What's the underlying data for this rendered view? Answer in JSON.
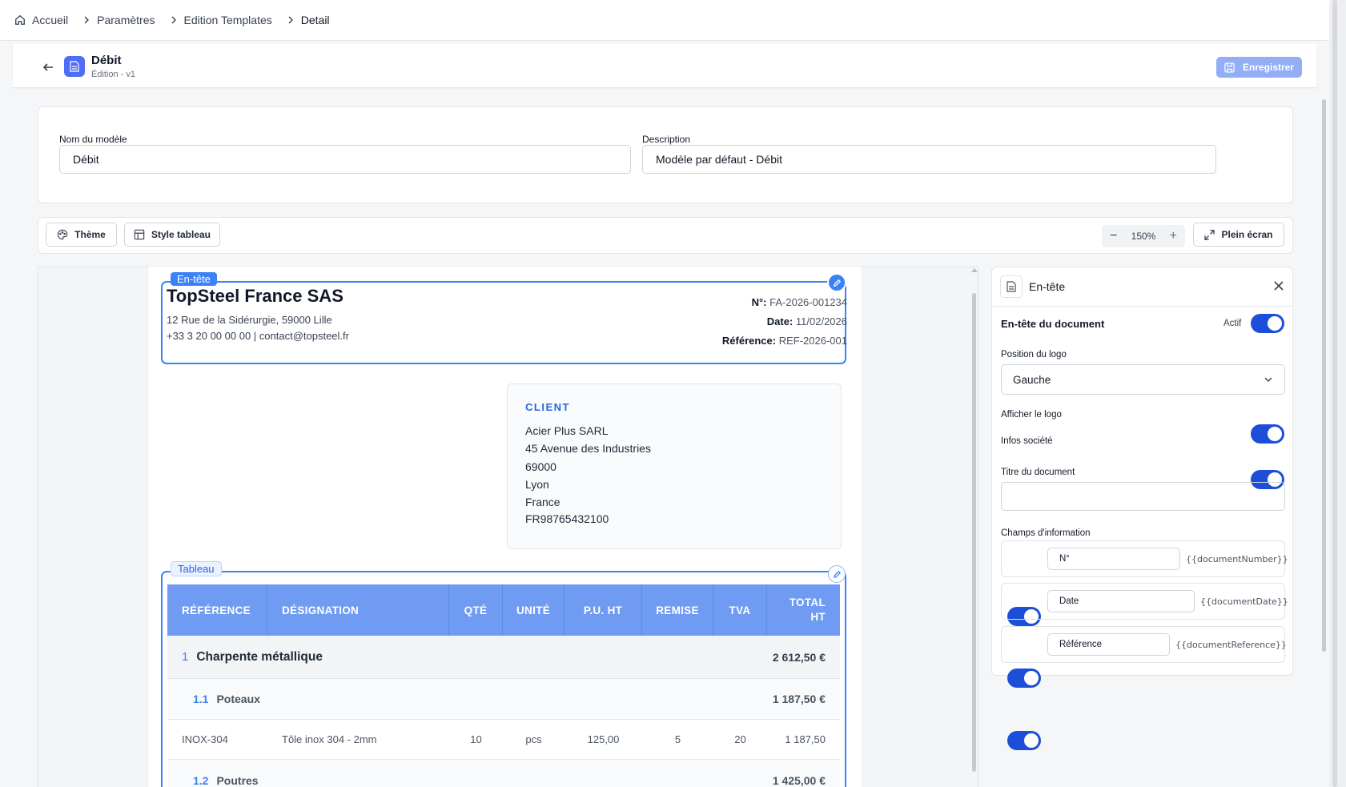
{
  "breadcrumb": [
    "Accueil",
    "Paramètres",
    "Edition Templates",
    "Detail"
  ],
  "header": {
    "title": "Débit",
    "subtitle": "Édition - v1",
    "save_label": "Enregistrer"
  },
  "form": {
    "name_label": "Nom du modèle",
    "name_value": "Débit",
    "desc_label": "Description",
    "desc_value": "Modèle par défaut - Débit"
  },
  "toolbar": {
    "theme": "Thème",
    "table_style": "Style tableau",
    "zoom": "150%",
    "fullscreen": "Plein écran"
  },
  "preview": {
    "header_tag": "En-tête",
    "company": "TopSteel France SAS",
    "address": "12 Rue de la Sidérurgie, 59000 Lille",
    "contact": "+33 3 20 00 00 00 | contact@topsteel.fr",
    "meta": [
      {
        "label": "N°:",
        "value": "FA-2026-001234"
      },
      {
        "label": "Date:",
        "value": "11/02/2026"
      },
      {
        "label": "Référence:",
        "value": "REF-2026-001"
      }
    ],
    "client_title": "CLIENT",
    "client_lines": [
      "Acier Plus SARL",
      "45 Avenue des Industries",
      "69000",
      "Lyon",
      "France",
      "FR98765432100"
    ],
    "table_tag": "Tableau",
    "columns": [
      "RÉFÉRENCE",
      "DÉSIGNATION",
      "QTÉ",
      "UNITÉ",
      "P.U. HT",
      "REMISE",
      "TVA",
      "TOTAL",
      "HT"
    ],
    "section": {
      "num": "1",
      "label": "Charpente métallique",
      "total": "2 612,50 €"
    },
    "sub1": {
      "num": "1.1",
      "label": "Poteaux",
      "total": "1 187,50 €"
    },
    "item": {
      "ref": "INOX-304",
      "desig": "Tôle inox 304 - 2mm",
      "qty": "10",
      "unit": "pcs",
      "pu": "125,00",
      "remise": "5",
      "tva": "20",
      "total": "1 187,50"
    },
    "sub2": {
      "num": "1.2",
      "label": "Poutres",
      "total": "1 425,00 €"
    }
  },
  "panel": {
    "title": "En-tête",
    "doc_header_label": "En-tête du document",
    "active_label": "Actif",
    "logo_pos_label": "Position du logo",
    "logo_pos_value": "Gauche",
    "show_logo": "Afficher le logo",
    "company_info": "Infos société",
    "doc_title_label": "Titre du document",
    "info_fields_label": "Champs d'information",
    "fields": [
      {
        "label": "N°",
        "var": "{{documentNumber}}"
      },
      {
        "label": "Date",
        "var": "{{documentDate}}"
      },
      {
        "label": "Référence",
        "var": "{{documentReference}}"
      }
    ]
  },
  "colors": {
    "accent": "#3b82f6",
    "table_header": "#6f9bf2",
    "toggle_on": "#1d4ed8",
    "save_button": "#93aef7"
  }
}
